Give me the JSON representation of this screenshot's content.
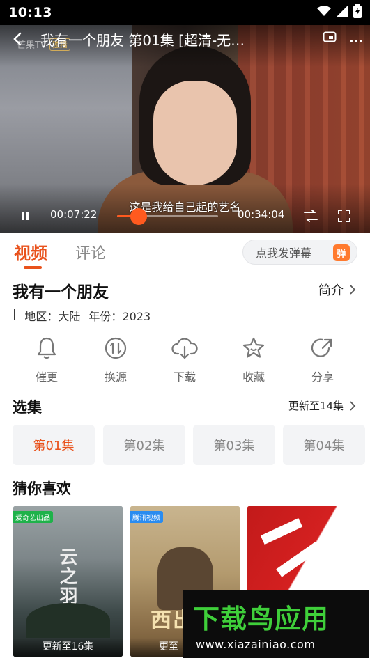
{
  "status_bar": {
    "time": "10:13"
  },
  "player": {
    "title": "我有一个朋友  第01集  [超清-无…",
    "watermark": {
      "name": "芒果TV",
      "badge": "独播"
    },
    "subtitle": "这是我给自己起的艺名",
    "current_time": "00:07:22",
    "total_time": "00:34:04",
    "progress": 0.216,
    "accent_color": "#ff5a1f"
  },
  "tabs": [
    {
      "label": "视频",
      "active": true
    },
    {
      "label": "评论",
      "active": false
    }
  ],
  "danmu": {
    "label": "点我发弹幕",
    "badge": "弹"
  },
  "show": {
    "title": "我有一个朋友",
    "intro_label": "简介",
    "meta_prefix": "|",
    "region": "地区：大陆",
    "year": "年份：2023"
  },
  "actions": [
    {
      "label": "催更",
      "icon": "bell-icon"
    },
    {
      "label": "换源",
      "icon": "switch-source-icon"
    },
    {
      "label": "下载",
      "icon": "cloud-download-icon"
    },
    {
      "label": "收藏",
      "icon": "star-icon"
    },
    {
      "label": "分享",
      "icon": "share-icon"
    }
  ],
  "episodes": {
    "section_title": "选集",
    "update_label": "更新至14集",
    "items": [
      {
        "label": "第01集",
        "active": true
      },
      {
        "label": "第02集",
        "active": false
      },
      {
        "label": "第03集",
        "active": false
      },
      {
        "label": "第04集",
        "active": false
      }
    ]
  },
  "recommend": {
    "section_title": "猜你喜欢",
    "items": [
      {
        "caption": "更新至16集",
        "tag": "爱奇艺出品",
        "art": "云之羽"
      },
      {
        "caption": "更至",
        "tag": "腾讯视频",
        "art": "西出"
      },
      {
        "caption": "",
        "tag": "",
        "art": ""
      }
    ]
  },
  "banner": {
    "name": "下载鸟应用",
    "url": "www.xiazainiao.com"
  },
  "colors": {
    "accent": "#e9521c",
    "brand_green": "#3fcf3a"
  }
}
